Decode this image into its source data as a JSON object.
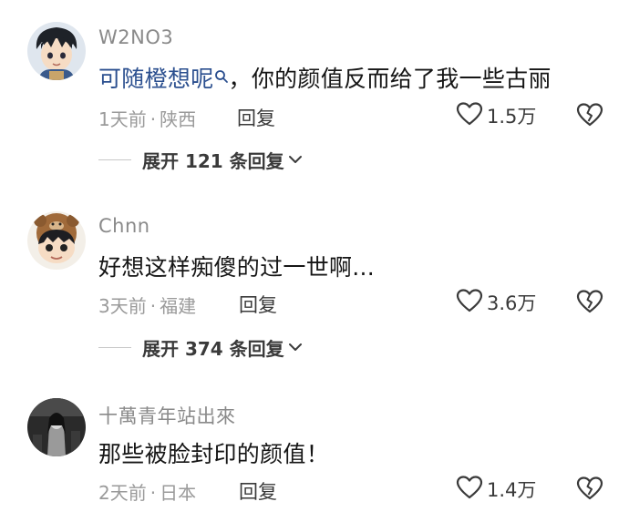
{
  "comments": [
    {
      "username": "W2NO3",
      "text_link": "可随橙想呢",
      "text_rest": "，你的颜值反而给了我一些古丽",
      "time": "1天前",
      "location": "陕西",
      "reply_label": "回复",
      "likes": "1.5万",
      "expand_label": "展开 121 条回复"
    },
    {
      "username": "Chnn",
      "text": "好想这样痴傻的过一世啊...",
      "time": "3天前",
      "location": "福建",
      "reply_label": "回复",
      "likes": "3.6万",
      "expand_label": "展开 374 条回复"
    },
    {
      "username": "十萬青年站出來",
      "text": "那些被脸封印的颜值！",
      "time": "2天前",
      "location": "日本",
      "reply_label": "回复",
      "likes": "1.4万"
    }
  ],
  "meta_separator": "·",
  "icons": {
    "like": "heart-outline-icon",
    "dislike": "broken-heart-icon",
    "expand": "chevron-down-icon",
    "search": "search-icon"
  },
  "colors": {
    "link": "#2b4f8f",
    "secondary_text": "#9a9a9a",
    "primary_text": "#161616"
  }
}
